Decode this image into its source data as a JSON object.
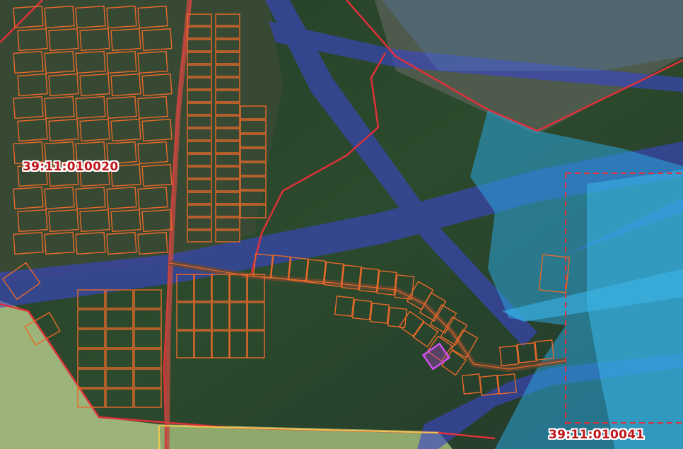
{
  "map": {
    "cadastral_labels": [
      {
        "id": "quarter-020",
        "text": "39:11:010020"
      },
      {
        "id": "quarter-041",
        "text": "39:11:010041"
      }
    ],
    "colors": {
      "forest": "#2a4a2c",
      "field": "#9bb67a",
      "parcel_outline": "#e8692a",
      "quarter_border": "#e0303a",
      "utility_zone_blue": "#3a4ad0",
      "water_zone_cyan": "#29a8e0",
      "highlighted_parcel": "#c040e0",
      "road_outline": "#f0c850"
    }
  }
}
